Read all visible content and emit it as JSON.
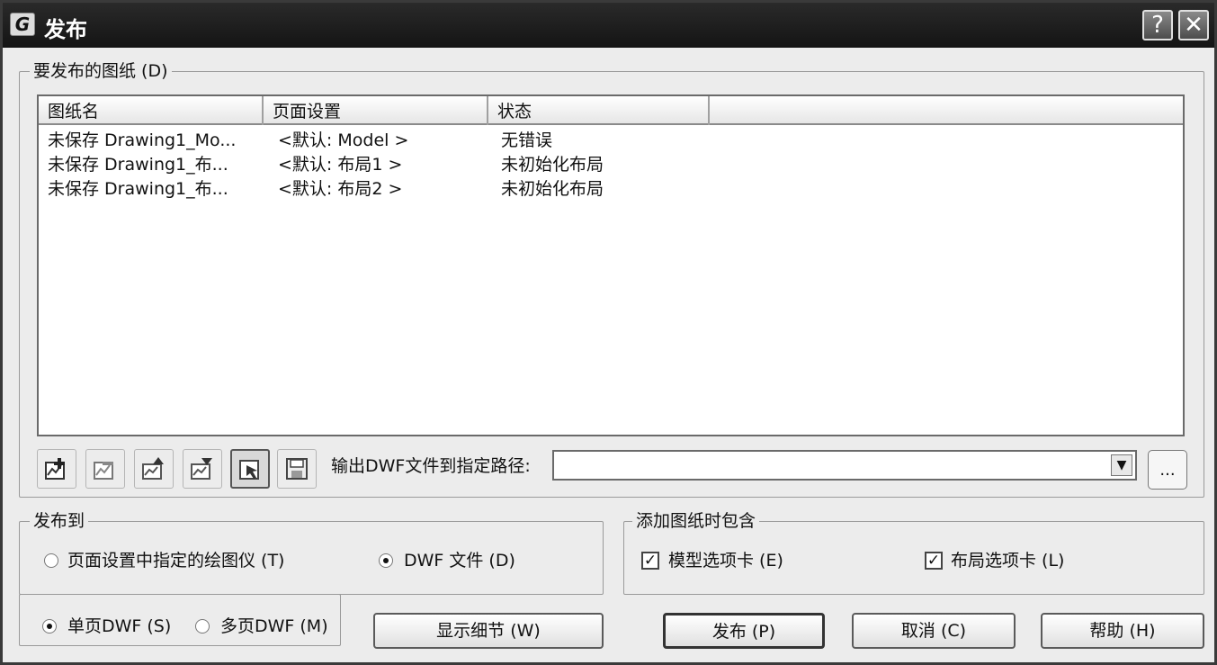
{
  "window": {
    "title": "发布",
    "app_icon": "G",
    "help_label": "?",
    "close_label": "✕"
  },
  "sheets_group": {
    "label": "要发布的图纸 (D)",
    "columns": [
      "图纸名",
      "页面设置",
      "状态"
    ],
    "rows": [
      {
        "name": "未保存 Drawing1_Mo...",
        "page_setup": "<默认: Model >",
        "status": "无错误"
      },
      {
        "name": "未保存 Drawing1_布...",
        "page_setup": "<默认: 布局1 >",
        "status": "未初始化布局"
      },
      {
        "name": "未保存 Drawing1_布...",
        "page_setup": "<默认: 布局2 >",
        "status": "未初始化布局"
      }
    ],
    "toolbar_icons": [
      "add-sheets-icon",
      "remove-sheets-icon",
      "move-up-icon",
      "move-down-icon",
      "preview-icon",
      "save-list-icon"
    ],
    "output_label": "输出DWF文件到指定路径:",
    "output_path": "",
    "browse_label": "..."
  },
  "publish_to": {
    "label": "发布到",
    "plotter_option": "页面设置中指定的绘图仪 (T)",
    "dwf_option": "DWF 文件 (D)",
    "selected": "dwf"
  },
  "include": {
    "label": "添加图纸时包含",
    "model_tab": "模型选项卡 (E)",
    "layout_tab": "布局选项卡 (L)",
    "model_checked": true,
    "layout_checked": true,
    "check_mark": "✓"
  },
  "dwf_type": {
    "single": "单页DWF (S)",
    "multi": "多页DWF (M)",
    "selected": "single"
  },
  "buttons": {
    "details": "显示细节 (W)",
    "publish": "发布 (P)",
    "cancel": "取消 (C)",
    "help": "帮助 (H)"
  }
}
